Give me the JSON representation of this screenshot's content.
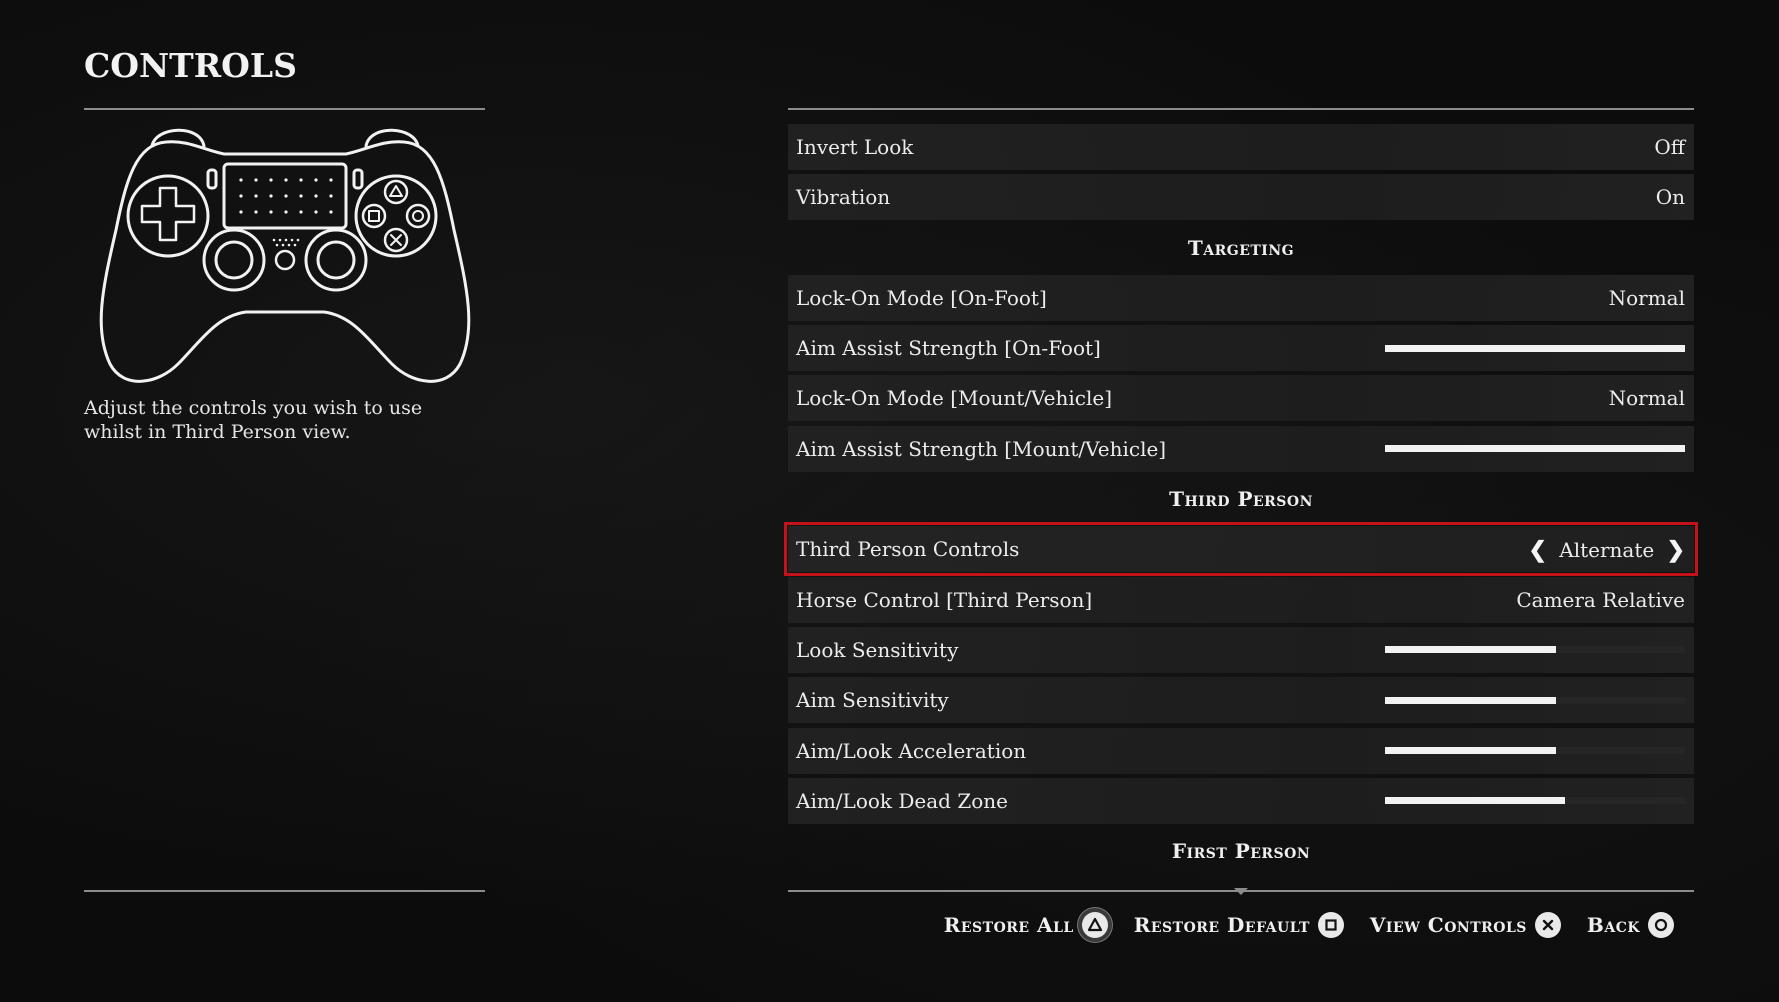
{
  "header": {
    "title": "CONTROLS"
  },
  "description": "Adjust the controls you wish to use whilst in Third Person view.",
  "settings": {
    "invert_look": {
      "label": "Invert Look",
      "value": "Off"
    },
    "vibration": {
      "label": "Vibration",
      "value": "On"
    },
    "targeting_header": "Targeting",
    "lockon_foot": {
      "label": "Lock-On Mode [On-Foot]",
      "value": "Normal"
    },
    "aim_assist_foot": {
      "label": "Aim Assist Strength [On-Foot]",
      "level": 1.0
    },
    "lockon_mount": {
      "label": "Lock-On Mode [Mount/Vehicle]",
      "value": "Normal"
    },
    "aim_assist_mount": {
      "label": "Aim Assist Strength [Mount/Vehicle]",
      "level": 1.0
    },
    "third_person_header": "Third Person",
    "third_person_controls": {
      "label": "Third Person Controls",
      "value": "Alternate"
    },
    "horse_control": {
      "label": "Horse Control [Third Person]",
      "value": "Camera Relative"
    },
    "look_sensitivity": {
      "label": "Look Sensitivity",
      "level": 0.57
    },
    "aim_sensitivity": {
      "label": "Aim Sensitivity",
      "level": 0.57
    },
    "aim_look_accel": {
      "label": "Aim/Look Acceleration",
      "level": 0.57
    },
    "aim_look_deadzone": {
      "label": "Aim/Look Dead Zone",
      "level": 0.6
    },
    "first_person_header": "First Person"
  },
  "footer": {
    "restore_all": "Restore All",
    "restore_default": "Restore Default",
    "view_controls": "View Controls",
    "back": "Back"
  },
  "colors": {
    "selection_outline": "#c3121a",
    "slider_fill": "#f2f2f2",
    "slider_track": "#262626"
  },
  "icons": {
    "restore_all": "triangle-button-icon",
    "restore_default": "square-button-icon",
    "view_controls": "cross-button-icon",
    "back": "circle-button-icon"
  }
}
